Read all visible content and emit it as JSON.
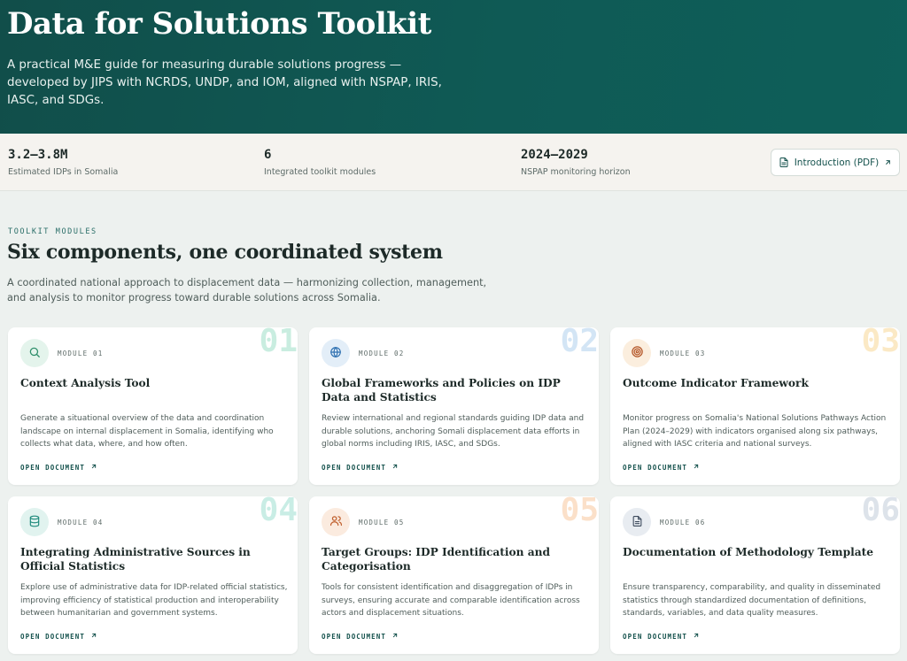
{
  "hero": {
    "title": "Data for Solutions Toolkit",
    "description": "A practical M&E guide for measuring durable solutions progress — developed by JIPS with NCRDS, UNDP, and IOM, aligned with NSPAP, IRIS, IASC, and SDGs."
  },
  "stats": [
    {
      "value": "3.2–3.8M",
      "label": "Estimated IDPs in Somalia"
    },
    {
      "value": "6",
      "label": "Integrated toolkit modules"
    },
    {
      "value": "2024–2029",
      "label": "NSPAP monitoring horizon"
    }
  ],
  "intro_button": {
    "label": "Introduction (PDF)",
    "icon": "document-icon"
  },
  "section": {
    "eyebrow": "TOOLKIT MODULES",
    "title": "Six components, one coordinated system",
    "description": "A coordinated national approach to displacement data — harmonizing collection, management, and analysis to monitor progress toward durable solutions across Somalia."
  },
  "modules": [
    {
      "number": "01",
      "module": "MODULE 01",
      "title": "Context Analysis Tool",
      "description": "Generate a situational overview of the data and coordination landscape on internal displacement in Somalia, identifying who collects what data, where, and how often.",
      "link": "OPEN DOCUMENT",
      "icon": "search-icon",
      "accent": "#2f8f6b",
      "icon_bg": "#e4f4ec",
      "num_color": "#c9ede0"
    },
    {
      "number": "02",
      "module": "MODULE 02",
      "title": "Global Frameworks and Policies on IDP Data and Statistics",
      "description": "Review international and regional standards guiding IDP data and durable solutions, anchoring Somali displacement data efforts in global norms including IRIS, IASC, and SDGs.",
      "link": "OPEN DOCUMENT",
      "icon": "globe-icon",
      "accent": "#2c6fb0",
      "icon_bg": "#e3eef8",
      "num_color": "#d3e5f5"
    },
    {
      "number": "03",
      "module": "MODULE 03",
      "title": "Outcome Indicator Framework",
      "description": "Monitor progress on Somalia's National Solutions Pathways Action Plan (2024–2029) with indicators organised along six pathways, aligned with IASC criteria and national surveys.",
      "link": "OPEN DOCUMENT",
      "icon": "target-icon",
      "accent": "#b5582a",
      "icon_bg": "#fbeede",
      "num_color": "#fbe9c5"
    },
    {
      "number": "04",
      "module": "MODULE 04",
      "title": "Integrating Administrative Sources in Official Statistics",
      "description": "Explore use of administrative data for IDP-related official statistics, improving efficiency of statistical production and interoperability between humanitarian and government systems.",
      "link": "OPEN DOCUMENT",
      "icon": "database-icon",
      "accent": "#1f8a7c",
      "icon_bg": "#e1f3ef",
      "num_color": "#c9ede5"
    },
    {
      "number": "05",
      "module": "MODULE 05",
      "title": "Target Groups: IDP Identification and Categorisation",
      "description": "Tools for consistent identification and disaggregation of IDPs in surveys, ensuring accurate and comparable identification across actors and displacement situations.",
      "link": "OPEN DOCUMENT",
      "icon": "users-icon",
      "accent": "#c0602e",
      "icon_bg": "#fbebdf",
      "num_color": "#fbe0c9"
    },
    {
      "number": "06",
      "module": "MODULE 06",
      "title": "Documentation of Methodology Template",
      "description": "Ensure transparency, comparability, and quality in disseminated statistics through standardized documentation of definitions, standards, variables, and data quality measures.",
      "link": "OPEN DOCUMENT",
      "icon": "document-icon",
      "accent": "#3d4a5c",
      "icon_bg": "#e8ecf1",
      "num_color": "#dde3ea"
    }
  ]
}
